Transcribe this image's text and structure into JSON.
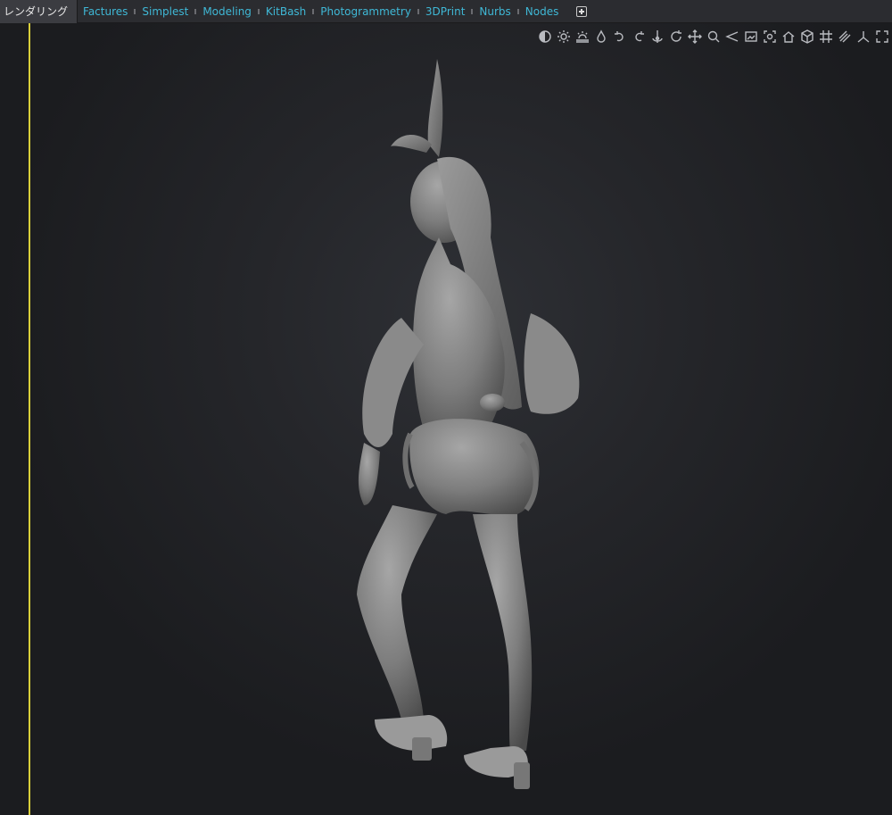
{
  "tabs": [
    {
      "label": "レンダリング",
      "active": true
    },
    {
      "label": "Factures"
    },
    {
      "label": "Simplest"
    },
    {
      "label": "Modeling"
    },
    {
      "label": "KitBash"
    },
    {
      "label": "Photogrammetry"
    },
    {
      "label": "3DPrint"
    },
    {
      "label": "Nurbs"
    },
    {
      "label": "Nodes"
    }
  ],
  "toolbar_icons": [
    "contrast-icon",
    "sun-icon",
    "horizon-light-icon",
    "drop-icon",
    "undo-icon",
    "redo-icon",
    "pivot-icon",
    "orbit-icon",
    "move-icon",
    "zoom-icon",
    "angle-icon",
    "frame-icon",
    "focus-icon",
    "home-icon",
    "cube-icon",
    "grid-icon",
    "snap-icon",
    "axis-icon",
    "fullscreen-icon"
  ],
  "colors": {
    "tab_text": "#3fb8d6",
    "active_tab_text": "#e6e6e6",
    "guide_line": "#d9cf3a",
    "viewport_bg": "#25262a",
    "model": "#8c8c8c"
  }
}
